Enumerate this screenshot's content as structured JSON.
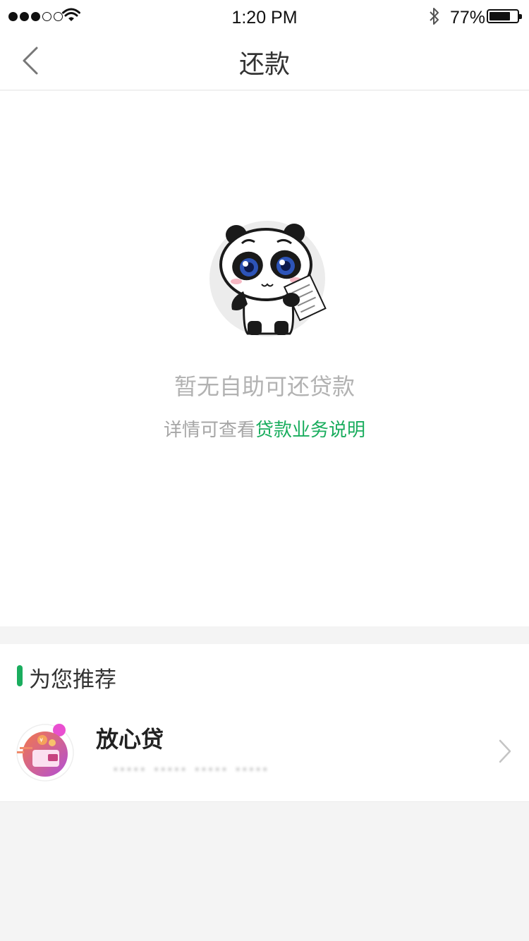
{
  "status_bar": {
    "time": "1:20 PM",
    "battery_percent": "77%",
    "battery_level": 0.77,
    "signal_bars": 3,
    "signal_total": 5,
    "icons": [
      "wifi-icon",
      "bluetooth-icon",
      "battery-icon"
    ]
  },
  "nav": {
    "title": "还款",
    "back_icon": "chevron-left-icon"
  },
  "empty_state": {
    "illustration": "panda-illustration",
    "title": "暂无自助可还贷款",
    "subtitle_prefix": "详情可查看",
    "subtitle_link": "贷款业务说明"
  },
  "recommend": {
    "section_title": "为您推荐",
    "products": [
      {
        "name": "放心贷",
        "description": "·····  ·····  ·····  ·····",
        "icon": "wallet-icon"
      }
    ]
  },
  "colors": {
    "accent": "#1aad5e",
    "muted_text": "#b2b2b2",
    "background": "#f4f4f4"
  }
}
